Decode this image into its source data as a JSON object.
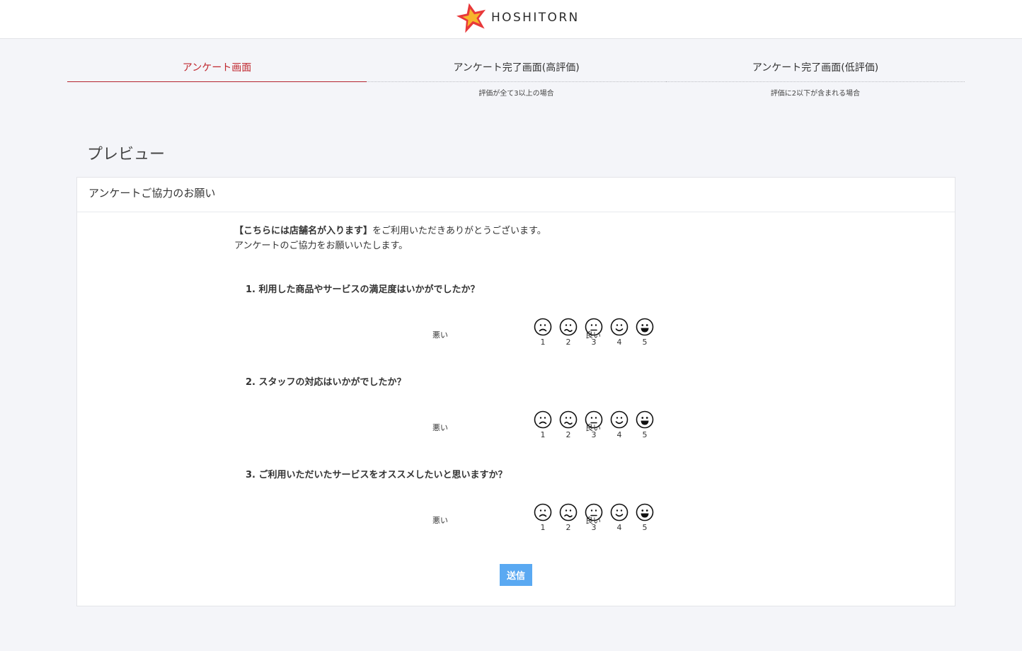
{
  "brand": {
    "name": "HOSHITORN"
  },
  "tabs": [
    {
      "label": "アンケート画面",
      "sub": ""
    },
    {
      "label": "アンケート完了画面(高評価)",
      "sub": "評価が全て3以上の場合"
    },
    {
      "label": "アンケート完了画面(低評価)",
      "sub": "評価に2以下が含まれる場合"
    }
  ],
  "preview": {
    "title": "プレビュー"
  },
  "card": {
    "header": "アンケートご協力のお願い",
    "intro_store": "【こちらには店舗名が入ります】",
    "intro_rest": "をご利用いただきありがとうございます。",
    "intro_line2": "アンケートのご協力をお願いいたします。"
  },
  "questions": [
    {
      "text": "1. 利用した商品やサービスの満足度はいかがでしたか？"
    },
    {
      "text": "2. スタッフの対応はいかがでしたか？"
    },
    {
      "text": "3. ご利用いただいたサービスをオススメしたいと思いますか？"
    }
  ],
  "scale": {
    "bad_label": "悪い",
    "good_label": "良い",
    "values": [
      "1",
      "2",
      "3",
      "4",
      "5"
    ],
    "faces": [
      "frown-icon",
      "worried-icon",
      "neutral-icon",
      "smile-icon",
      "grin-icon"
    ]
  },
  "submit": {
    "label": "送信"
  },
  "colors": {
    "accent": "#c0282f",
    "button": "#5aa9f2",
    "background": "#f4f5f9"
  }
}
